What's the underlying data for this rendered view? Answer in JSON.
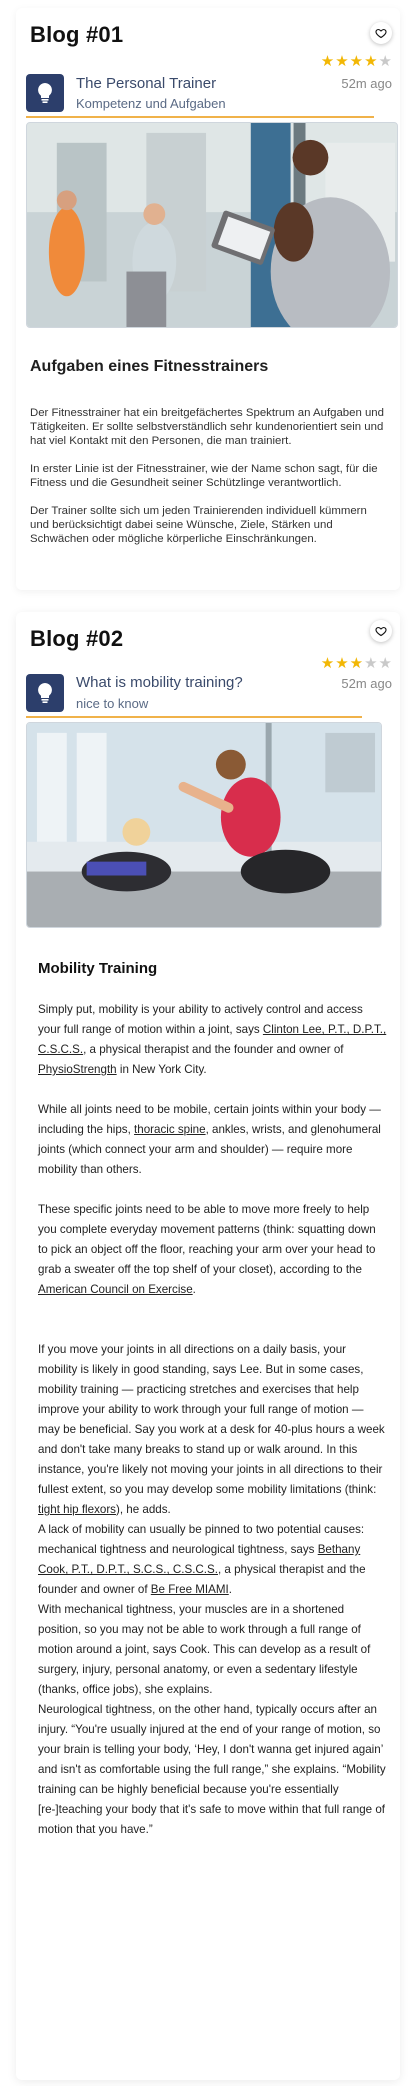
{
  "posts": [
    {
      "heading": "Blog #01",
      "rating": 4,
      "max_rating": 5,
      "time": "52m ago",
      "title": "The Personal Trainer",
      "subtitle": "Kompetenz und Aufgaben",
      "article_title": "Aufgaben eines Fitnesstrainers",
      "paragraphs": [
        "Der Fitnesstrainer hat ein breitgefächertes Spektrum an Aufgaben und Tätigkeiten. Er sollte selbstverständlich sehr kundenorientiert sein und hat viel Kontakt mit den Personen, die man trainiert.",
        "In erster Linie ist der Fitnesstrainer, wie der Name schon sagt, für die Fitness und die Gesundheit seiner Schützlinge verantwortlich.",
        "Der Trainer sollte sich um jeden Trainierenden individuell kümmern und berücksichtigt dabei seine Wünsche, Ziele, Stärken und Schwächen oder mögliche körperliche Einschränkungen."
      ]
    },
    {
      "heading": "Blog #02",
      "rating": 3,
      "max_rating": 5,
      "time": "52m ago",
      "title": "What is mobility training?",
      "subtitle": "nice to know",
      "article_title": "Mobility Training",
      "p1_a": "Simply put, mobility is your ability to actively control and access your full range of motion within a joint, says ",
      "p1_link1": "Clinton Lee, P.T., D.P.T., C.S.C.S.",
      "p1_b": ", a physical therapist and the founder and owner of ",
      "p1_link2": "PhysioStrength",
      "p1_c": " in New York City.",
      "p2_a": "While all joints need to be mobile, certain joints within your body — including the hips, ",
      "p2_link": "thoracic spine",
      "p2_b": ", ankles, wrists, and glenohumeral joints (which connect your arm and shoulder) — require more mobility than others.",
      "p3_a": "These specific joints need to be able to move more freely to help you complete everyday movement patterns (think: squatting down to pick an object off the floor, reaching your arm over your head to grab a sweater off the top shelf of your closet), according to the ",
      "p3_link": "American Council on Exercise",
      "p3_b": ".",
      "p4_a": "If you move your joints in all directions on a daily basis, your mobility is likely in good standing, says Lee. But in some cases, mobility training — practicing stretches and exercises that help improve your ability to work through your full range of motion — may be beneficial. Say you work at a desk for 40-plus hours a week and don't take many breaks to stand up or walk around. In this instance, you're likely not moving your joints in all directions to their fullest extent, so you may develop some mobility limitations (think: ",
      "p4_link": "tight hip flexors",
      "p4_b": "), he adds.",
      "p5_a": "A lack of mobility can usually be pinned to two potential causes: mechanical tightness and neurological tightness, says ",
      "p5_link1": "Bethany Cook, P.T., D.P.T., S.C.S., C.S.C.S.",
      "p5_b": ", a physical therapist and the founder and owner of ",
      "p5_link2": "Be Free MIAMI",
      "p5_c": ".",
      "p6": "With mechanical tightness, your muscles are in a shortened position, so you may not be able to work through a full range of motion around a joint, says Cook. This can develop as a result of surgery, injury, personal anatomy, or even a sedentary lifestyle (thanks, office jobs), she explains.",
      "p7": "Neurological tightness, on the other hand, typically occurs after an injury. “You're usually injured at the end of your range of motion, so your brain is telling your body, ‘Hey, I don't wanna get injured again’ and isn't as comfortable using the full range,” she explains. “Mobility training can be highly beneficial because you're essentially [re-]teaching your body that it's safe to move within that full range of motion that you have.”"
    }
  ],
  "colors": {
    "accent": "#f0b24a",
    "avatar": "#2c3e6b",
    "star_on": "#f2b705",
    "star_off": "#c9c9c9"
  },
  "icons": {
    "favorite": "heart-icon",
    "avatar": "lightbulb-icon",
    "rating": "star-icon"
  }
}
